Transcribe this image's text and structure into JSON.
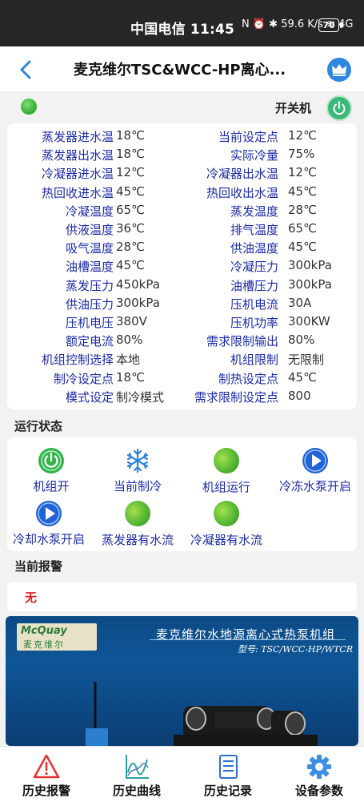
{
  "status_bar": {
    "carrier_time": "中国电信 11:45",
    "indicators": "N ⏰ ✱ 59.6 K/s ≋ 4G",
    "battery": "70"
  },
  "header": {
    "title": "麦克维尔TSC&WCC-HP离心...",
    "back_icon": "chevron-left-icon",
    "crown_icon": "crown-icon"
  },
  "power": {
    "label": "开关机",
    "indicator_color": "#3bb83b",
    "button_color": "#3cb878"
  },
  "params": [
    {
      "ll": "蒸发器进水温",
      "lv": "18℃",
      "rl": "当前设定点",
      "rv": "12℃"
    },
    {
      "ll": "蒸发器出水温",
      "lv": "18℃",
      "rl": "实际冷量",
      "rv": "75%"
    },
    {
      "ll": "冷凝器进水温",
      "lv": "12℃",
      "rl": "冷凝器出水温",
      "rv": "12℃"
    },
    {
      "ll": "热回收进水温",
      "lv": "45℃",
      "rl": "热回收出水温",
      "rv": "45℃"
    },
    {
      "ll": "冷凝温度",
      "lv": "65℃",
      "rl": "蒸发温度",
      "rv": "28℃"
    },
    {
      "ll": "供液温度",
      "lv": "36℃",
      "rl": "排气温度",
      "rv": "65℃"
    },
    {
      "ll": "吸气温度",
      "lv": "28℃",
      "rl": "供油温度",
      "rv": "45℃"
    },
    {
      "ll": "油槽温度",
      "lv": "45℃",
      "rl": "冷凝压力",
      "rv": "300kPa"
    },
    {
      "ll": "蒸发压力",
      "lv": "450kPa",
      "rl": "油槽压力",
      "rv": "300kPa"
    },
    {
      "ll": "供油压力",
      "lv": "300kPa",
      "rl": "压机电流",
      "rv": "30A"
    },
    {
      "ll": "压机电压",
      "lv": "380V",
      "rl": "压机功率",
      "rv": "300KW"
    },
    {
      "ll": "额定电流",
      "lv": "80%",
      "rl": "需求限制输出",
      "rv": "80%"
    },
    {
      "ll": "机组控制选择",
      "lv": "本地",
      "rl": "机组限制",
      "rv": "无限制"
    },
    {
      "ll": "制冷设定点",
      "lv": "18℃",
      "rl": "制热设定点",
      "rv": "45℃"
    },
    {
      "ll": "模式设定",
      "lv": "制冷模式",
      "rl": "需求限制设定点",
      "rv": "800"
    }
  ],
  "run_status": {
    "title": "运行状态",
    "items": [
      {
        "label": "机组开",
        "icon": "power-on-icon"
      },
      {
        "label": "当前制冷",
        "icon": "snowflake-icon"
      },
      {
        "label": "机组运行",
        "icon": "green-ball-icon"
      },
      {
        "label": "冷冻水泵开启",
        "icon": "play-icon"
      },
      {
        "label": "冷却水泵开启",
        "icon": "play-icon"
      },
      {
        "label": "蒸发器有水流",
        "icon": "green-ball-icon"
      },
      {
        "label": "冷凝器有水流",
        "icon": "green-ball-icon"
      }
    ]
  },
  "alarm": {
    "title": "当前报警",
    "text": "无",
    "color": "#e02020"
  },
  "banner": {
    "logo_en": "McQuay",
    "logo_cn": "麦克维尔",
    "headline": "麦克维尔水地源离心式热泵机组",
    "model": "型号: TSC/WCC-HP/WTCR"
  },
  "bottom_nav": [
    {
      "label": "历史报警",
      "icon": "warning-icon"
    },
    {
      "label": "历史曲线",
      "icon": "chart-icon"
    },
    {
      "label": "历史记录",
      "icon": "document-icon"
    },
    {
      "label": "设备参数",
      "icon": "gear-icon"
    }
  ]
}
